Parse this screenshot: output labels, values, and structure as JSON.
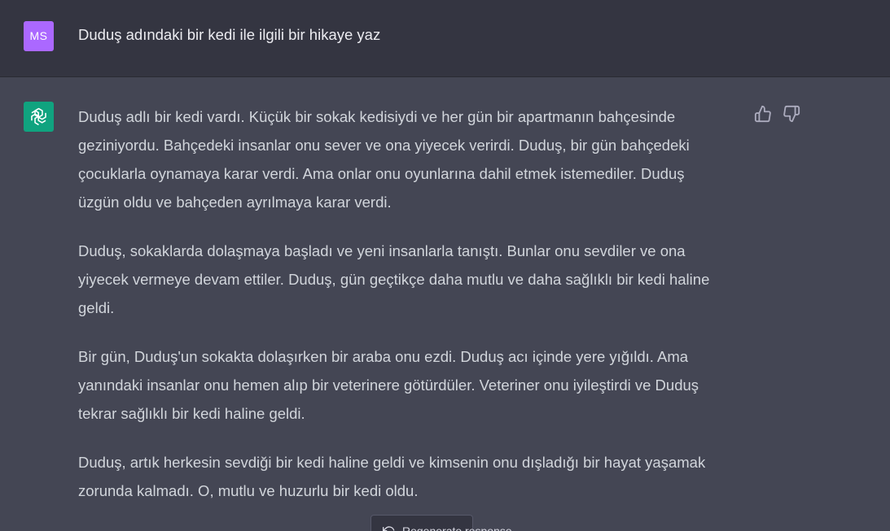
{
  "user": {
    "avatar_initials": "MS",
    "avatar_color": "#ab68ff",
    "prompt": "Duduş adındaki bir kedi ile ilgili bir hikaye yaz"
  },
  "assistant": {
    "avatar_icon": "openai-logo-icon",
    "avatar_color": "#10a37f",
    "paragraphs": [
      "Duduş adlı bir kedi vardı. Küçük bir sokak kedisiydi ve her gün bir apartmanın bahçesinde geziniyordu. Bahçedeki insanlar onu sever ve ona yiyecek verirdi. Duduş, bir gün bahçedeki çocuklarla oynamaya karar verdi. Ama onlar onu oyunlarına dahil etmek istemediler. Duduş üzgün oldu ve bahçeden ayrılmaya karar verdi.",
      "Duduş, sokaklarda dolaşmaya başladı ve yeni insanlarla tanıştı. Bunlar onu sevdiler ve ona yiyecek vermeye devam ettiler. Duduş, gün geçtikçe daha mutlu ve daha sağlıklı bir kedi haline geldi.",
      "Bir gün, Duduş'un sokakta dolaşırken bir araba onu ezdi. Duduş acı içinde yere yığıldı. Ama yanındaki insanlar onu hemen alıp bir veterinere götürdüler. Veteriner onu iyileştirdi ve Duduş tekrar sağlıklı bir kedi haline geldi.",
      "Duduş, artık herkesin sevdiği bir kedi haline geldi ve kimsenin onu dışladığı bir hayat yaşamak zorunda kalmadı. O, mutlu ve huzurlu bir kedi oldu."
    ],
    "feedback": {
      "up_icon": "thumbs-up-icon",
      "down_icon": "thumbs-down-icon"
    }
  },
  "regenerate": {
    "label": "Regenerate response",
    "icon": "refresh-icon"
  },
  "colors": {
    "user_bg": "#343541",
    "assistant_bg": "#444654",
    "text": "#d1d5db"
  }
}
